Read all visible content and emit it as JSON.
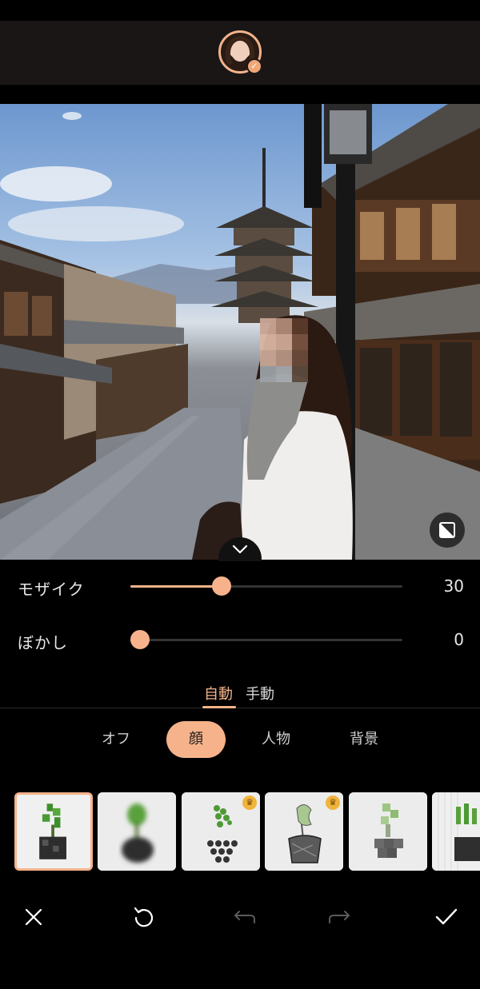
{
  "header": {
    "avatar_icon": "user-avatar-verified"
  },
  "photo": {
    "compare_icon": "compare-icon",
    "collapse_icon": "chevron-down-icon"
  },
  "sliders": [
    {
      "label": "モザイク",
      "value": "30",
      "fraction": 0.3
    },
    {
      "label": "ぼかし",
      "value": "0",
      "fraction": 0.0
    }
  ],
  "modes": {
    "auto": "自動",
    "manual": "手動",
    "active": "auto"
  },
  "targets": [
    {
      "label": "オフ",
      "active": false
    },
    {
      "label": "顔",
      "active": true
    },
    {
      "label": "人物",
      "active": false
    },
    {
      "label": "背景",
      "active": false
    }
  ],
  "effects": [
    {
      "name": "original",
      "premium": false,
      "selected": true
    },
    {
      "name": "blur",
      "premium": false,
      "selected": false
    },
    {
      "name": "dots",
      "premium": true,
      "selected": false
    },
    {
      "name": "sketch",
      "premium": true,
      "selected": false
    },
    {
      "name": "hexagon",
      "premium": false,
      "selected": false
    },
    {
      "name": "stripes",
      "premium": false,
      "selected": false
    }
  ],
  "bottombar": {
    "close_icon": "close-icon",
    "reset_icon": "reset-icon",
    "undo_icon": "undo-icon",
    "redo_icon": "redo-icon",
    "confirm_icon": "check-icon"
  },
  "colors": {
    "accent": "#f6b38b",
    "background": "#000000",
    "premium": "#f0b43c"
  }
}
